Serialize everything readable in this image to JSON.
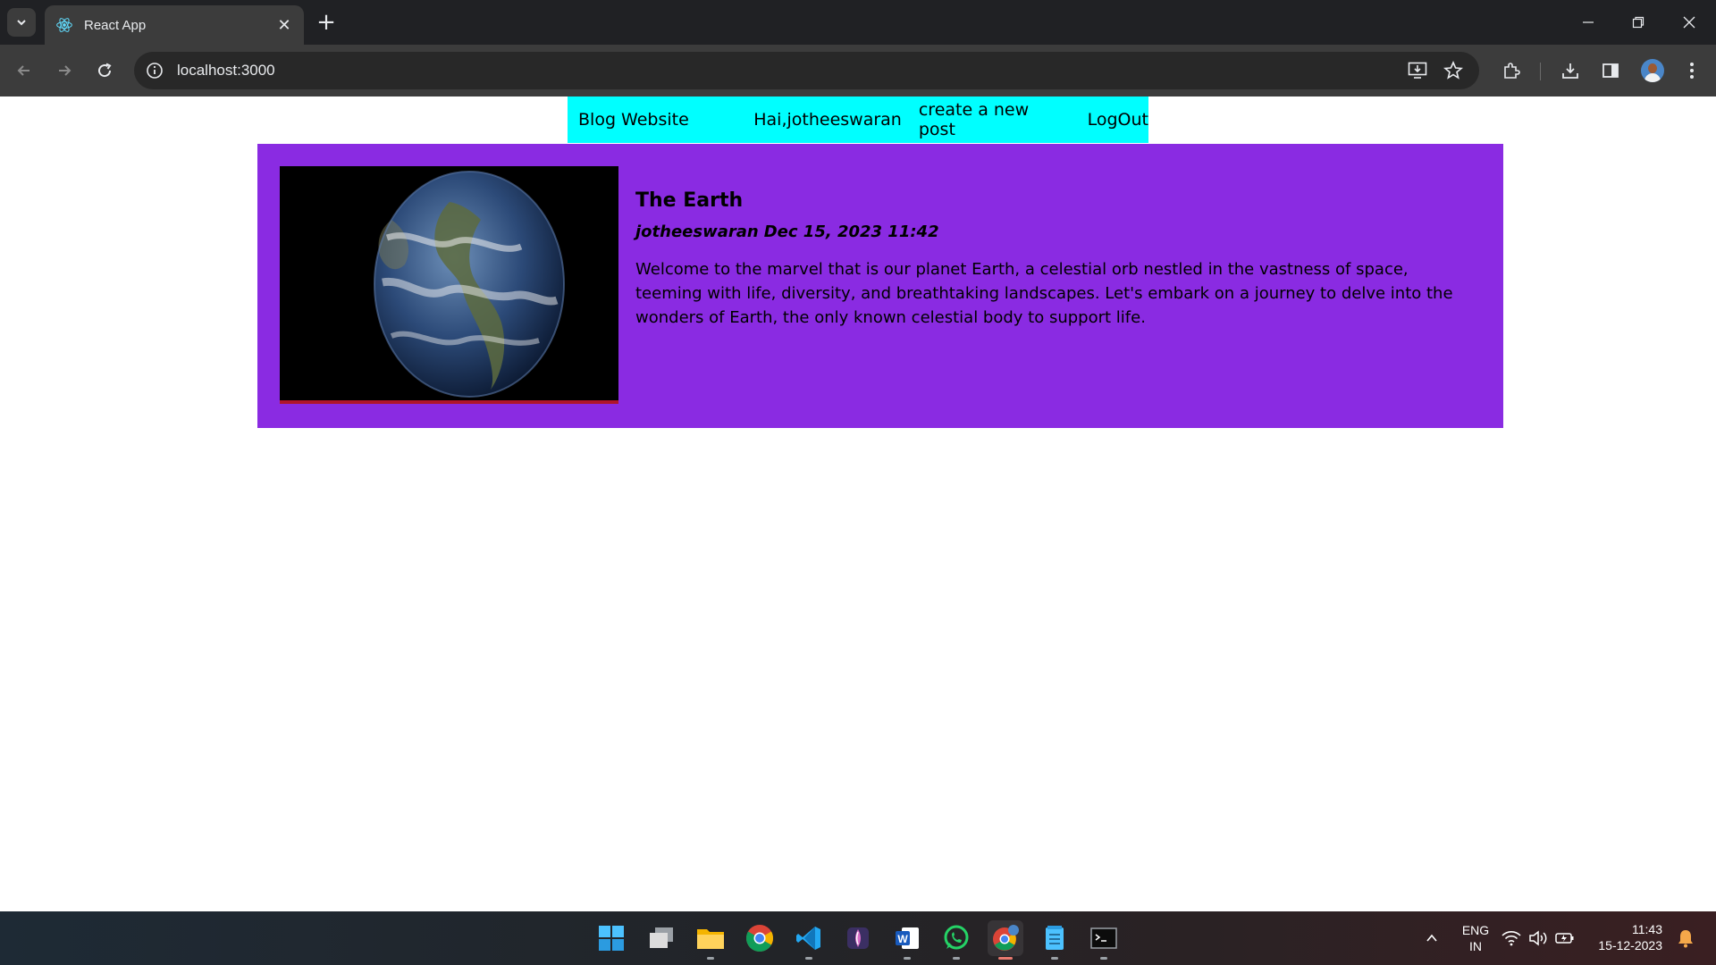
{
  "browser": {
    "tab_title": "React App",
    "url": "localhost:3000"
  },
  "header": {
    "logo": "Blog Website",
    "greeting": "Hai,jotheeswaran",
    "create_link": "create a new post",
    "logout_link": "LogOut"
  },
  "posts": [
    {
      "title": "The Earth",
      "author": "jotheeswaran",
      "date": "Dec 15, 2023 11:42",
      "summary": "Welcome to the marvel that is our planet Earth, a celestial orb nestled in the vastness of space, teeming with life, diversity, and breathtaking landscapes. Let's embark on a journey to delve into the wonders of Earth, the only known celestial body to support life.",
      "image": "earth-photo"
    }
  ],
  "taskbar": {
    "apps": [
      "start-icon",
      "task-view-icon",
      "file-explorer-icon",
      "chrome-icon",
      "vscode-icon",
      "mongodb-compass-icon",
      "word-icon",
      "whatsapp-icon",
      "chrome-profile-icon",
      "notepad-icon",
      "terminal-icon"
    ],
    "language": "ENG",
    "region": "IN",
    "time": "11:43",
    "date": "15-12-2023"
  },
  "colors": {
    "header_bg": "#00ffff",
    "post_bg": "#8a2be2",
    "image_border": "#b0152a"
  }
}
